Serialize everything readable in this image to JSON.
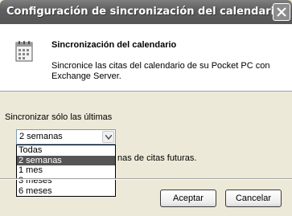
{
  "window": {
    "title": "Configuración de sincronización del calendario"
  },
  "header": {
    "title": "Sincronización del calendario",
    "description": "Sincronice las citas del calendario de su Pocket PC con Exchange Server."
  },
  "sync": {
    "label": "Sincronizar sólo las últimas",
    "selected_value": "2 semanas",
    "options": [
      "Todas",
      "2 semanas",
      "1 mes",
      "3 meses",
      "6 meses"
    ],
    "future_label_visible": "nas de citas futuras."
  },
  "buttons": {
    "ok_label": "Aceptar",
    "cancel_label": "Cancelar"
  },
  "colors": {
    "titlebar": "#5f5f5f",
    "selected_item": "#555555",
    "dialog_bg": "#ECE9D8"
  }
}
